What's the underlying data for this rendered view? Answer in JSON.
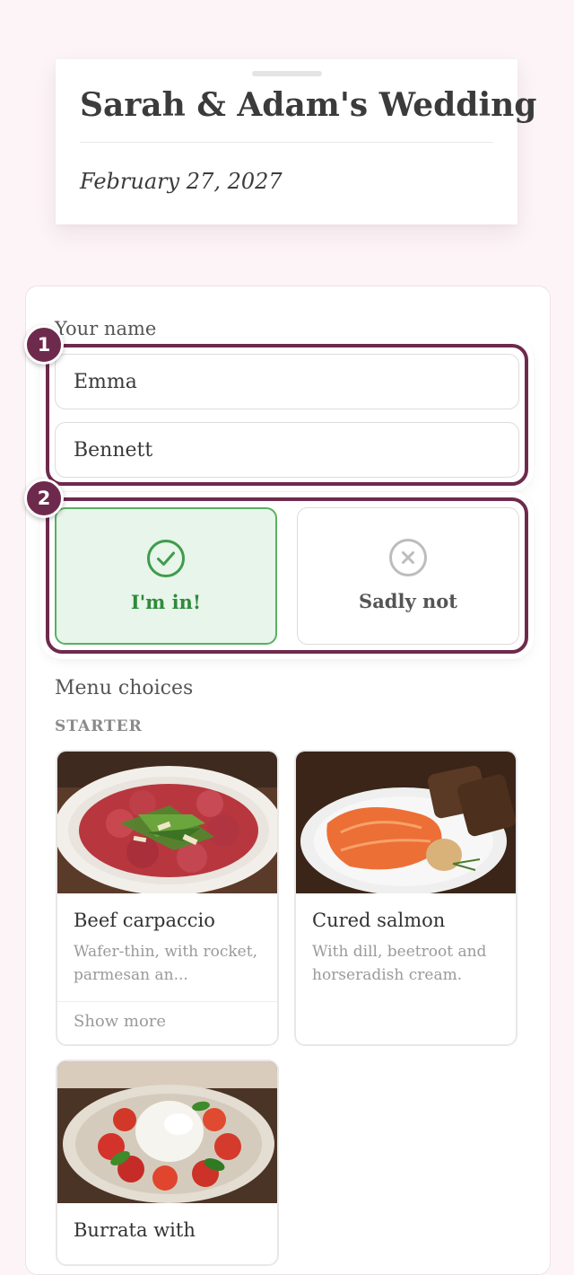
{
  "header": {
    "title": "Sarah & Adam's Wedding",
    "date": "February 27, 2027"
  },
  "form": {
    "name_label": "Your name",
    "first_name": "Emma",
    "last_name": "Bennett",
    "badges": [
      "1",
      "2"
    ],
    "rsvp": {
      "yes_label": "I'm in!",
      "no_label": "Sadly not",
      "selected": "yes"
    },
    "menu": {
      "title": "Menu choices",
      "course": "STARTER",
      "dishes": [
        {
          "name": "Beef carpaccio",
          "description": "Wafer-thin, with rocket, parmesan an...",
          "more_label": "Show more"
        },
        {
          "name": "Cured salmon",
          "description": "With dill, beetroot and horseradish cream."
        },
        {
          "name": "Burrata with"
        }
      ]
    }
  },
  "colors": {
    "accent": "#6e2a4d",
    "selected_green": "#58b064",
    "background": "#fcf4f6"
  },
  "icons": {
    "yes": "check-circle-icon",
    "no": "x-circle-icon"
  }
}
